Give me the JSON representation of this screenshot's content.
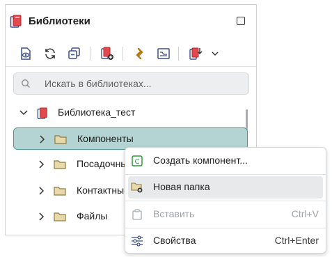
{
  "panel": {
    "title": "Библиотеки",
    "toolbar": {
      "buttons": [
        {
          "name": "show-library-icon"
        },
        {
          "name": "refresh-icon"
        },
        {
          "name": "collapse-all-icon"
        },
        {
          "name": "add-library-icon"
        },
        {
          "name": "link-icon"
        },
        {
          "name": "properties-panel-icon"
        },
        {
          "name": "import-library-icon"
        }
      ]
    },
    "search": {
      "placeholder": "Искать в библиотеках..."
    }
  },
  "tree": {
    "items": [
      {
        "label": "Библиотека_тест",
        "level": 0,
        "expanded": true
      },
      {
        "label": "Компоненты",
        "level": 1,
        "selected": true
      },
      {
        "label": "Посадочные места",
        "level": 1
      },
      {
        "label": "Контактные площадки",
        "level": 1
      },
      {
        "label": "Файлы",
        "level": 1
      }
    ]
  },
  "context_menu": {
    "items": [
      {
        "label": "Создать компонент...",
        "shortcut": "",
        "icon": "create-component-icon"
      },
      {
        "label": "Новая папка",
        "shortcut": "",
        "icon": "new-folder-icon",
        "hover": true
      },
      {
        "label": "Вставить",
        "shortcut": "Ctrl+V",
        "icon": "paste-icon",
        "disabled": true
      },
      {
        "label": "Свойства",
        "shortcut": "Ctrl+Enter",
        "icon": "properties-icon"
      }
    ]
  },
  "colors": {
    "selection": "#b3d4d2",
    "selection_border": "#4d9a95",
    "library_icon": "#d9363e",
    "folder": "#e2cf9a",
    "accent_green": "#2e9b3f"
  }
}
